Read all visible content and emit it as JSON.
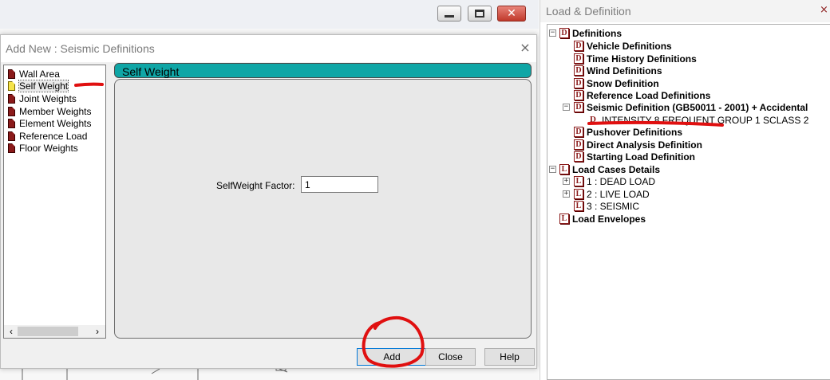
{
  "dialog": {
    "title": "Add New : Seismic Definitions",
    "close_glyph": "×",
    "list_items": [
      {
        "label": "Wall Area",
        "icon": "document-icon",
        "selected": false
      },
      {
        "label": "Self Weight",
        "icon": "document-icon-highlight",
        "selected": true
      },
      {
        "label": "Joint Weights",
        "icon": "document-icon",
        "selected": false
      },
      {
        "label": "Member Weights",
        "icon": "document-icon",
        "selected": false
      },
      {
        "label": "Element Weights",
        "icon": "document-icon",
        "selected": false
      },
      {
        "label": "Reference Load",
        "icon": "document-icon",
        "selected": false
      },
      {
        "label": "Floor Weights",
        "icon": "document-icon",
        "selected": false
      }
    ],
    "scroll_left_glyph": "‹",
    "scroll_right_glyph": "›",
    "panel_title": "Self Weight",
    "factor_label": "SelfWeight Factor:",
    "factor_value": "1",
    "buttons": {
      "add": "Add",
      "close": "Close",
      "help": "Help"
    }
  },
  "tree": {
    "title": "Load & Definition",
    "close_glyph": "×",
    "nodes": [
      {
        "label": "Definitions",
        "badge": "D",
        "bold": true,
        "expander": "−"
      },
      {
        "label": "Vehicle Definitions",
        "badge": "D",
        "bold": true
      },
      {
        "label": "Time History Definitions",
        "badge": "D",
        "bold": true
      },
      {
        "label": "Wind Definitions",
        "badge": "D",
        "bold": true
      },
      {
        "label": "Snow Definition",
        "badge": "D",
        "bold": true
      },
      {
        "label": "Reference Load Definitions",
        "badge": "D",
        "bold": true
      },
      {
        "label": "Seismic Definition (GB50011 - 2001) + Accidental",
        "badge": "D",
        "bold": true,
        "expander": "−"
      },
      {
        "label": "INTENSITY 8 FREQUENT GROUP 1 SCLASS 2",
        "badge": "D",
        "bold": false
      },
      {
        "label": "Pushover Definitions",
        "badge": "D",
        "bold": true
      },
      {
        "label": "Direct Analysis Definition",
        "badge": "D",
        "bold": true
      },
      {
        "label": "Starting Load Definition",
        "badge": "D",
        "bold": true
      },
      {
        "label": "Load Cases Details",
        "badge": "L",
        "bold": true,
        "expander": "−"
      },
      {
        "label": "1 : DEAD LOAD",
        "badge": "L",
        "bold": false,
        "expander": "+"
      },
      {
        "label": "2 : LIVE LOAD",
        "badge": "L",
        "bold": false,
        "expander": "+"
      },
      {
        "label": "3 : SEISMIC",
        "badge": "L",
        "bold": false
      },
      {
        "label": "Load Envelopes",
        "badge": "L",
        "bold": true
      }
    ]
  },
  "colors": {
    "panel_header": "#0fa6a6",
    "icon_red": "#8b1a1a",
    "annotation_red": "#e01010"
  }
}
